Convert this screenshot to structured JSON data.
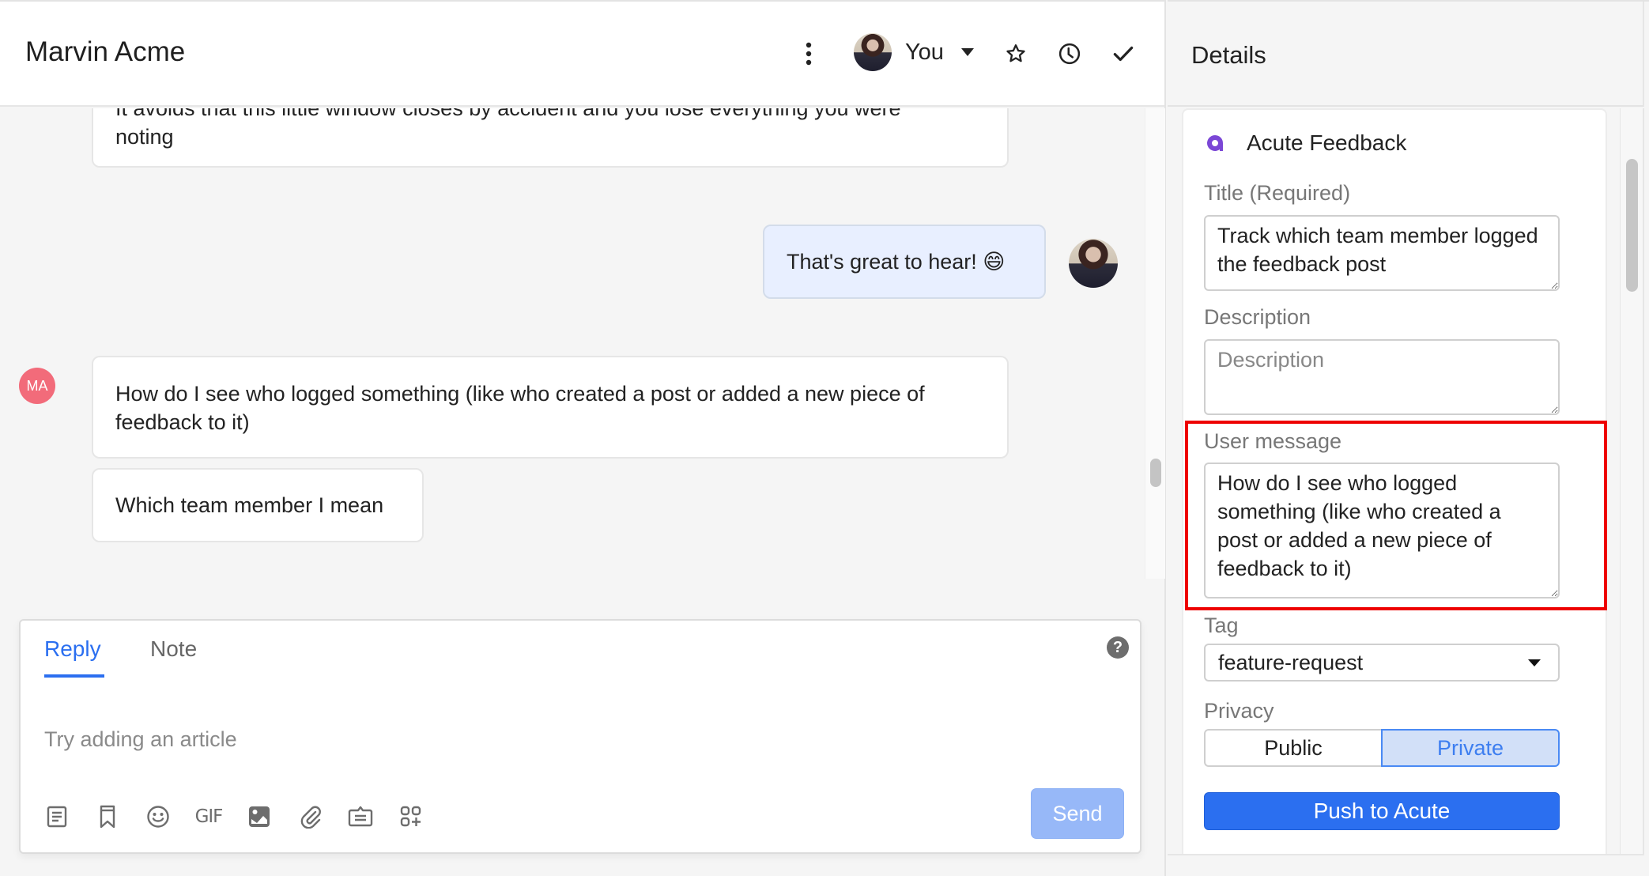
{
  "conversation": {
    "title": "Marvin Acme",
    "assignee": "You",
    "header_icons": [
      "more-vertical-icon",
      "star-icon",
      "clock-icon",
      "check-icon"
    ]
  },
  "messages": [
    {
      "author": "customer",
      "text_cut": "It avoids that this little window closes by accident and you lose everything you were",
      "text_last": "noting"
    },
    {
      "author": "agent",
      "text": "That's great to hear! 😄"
    },
    {
      "author": "customer",
      "avatar_initials": "MA",
      "text": "How do I see who logged something (like who created a post or added a new piece of feedback to it)"
    },
    {
      "author": "customer",
      "text": "Which team member I mean"
    }
  ],
  "composer": {
    "tabs": [
      {
        "label": "Reply",
        "active": true
      },
      {
        "label": "Note",
        "active": false
      }
    ],
    "placeholder": "Try adding an article",
    "value": "",
    "help_label": "?",
    "tools": [
      {
        "name": "article-icon"
      },
      {
        "name": "bookmark-icon"
      },
      {
        "name": "emoji-icon"
      },
      {
        "name": "gif-icon",
        "label": "GIF"
      },
      {
        "name": "image-icon"
      },
      {
        "name": "attachment-icon"
      },
      {
        "name": "macro-icon"
      },
      {
        "name": "apps-add-icon"
      }
    ],
    "send_label": "Send"
  },
  "details": {
    "title": "Details",
    "app_name": "Acute Feedback",
    "brand_color": "#7b47d6",
    "fields": {
      "title_label": "Title (Required)",
      "title_value": "Track which team member logged the feedback post",
      "description_label": "Description",
      "description_placeholder": "Description",
      "description_value": "",
      "user_message_label": "User message",
      "user_message_value": "How do I see who logged something (like who created a post or added a new piece of feedback to it)",
      "tag_label": "Tag",
      "tag_value": "feature-request",
      "privacy_label": "Privacy",
      "privacy_options": [
        "Public",
        "Private"
      ],
      "privacy_selected": "Private"
    },
    "push_label": "Push to Acute"
  },
  "colors": {
    "accent": "#2b6ff0",
    "send_disabled": "#97b8f8",
    "highlight": "#ee0000",
    "customer_avatar": "#f26b7a",
    "agent_bubble": "#e8efff"
  }
}
